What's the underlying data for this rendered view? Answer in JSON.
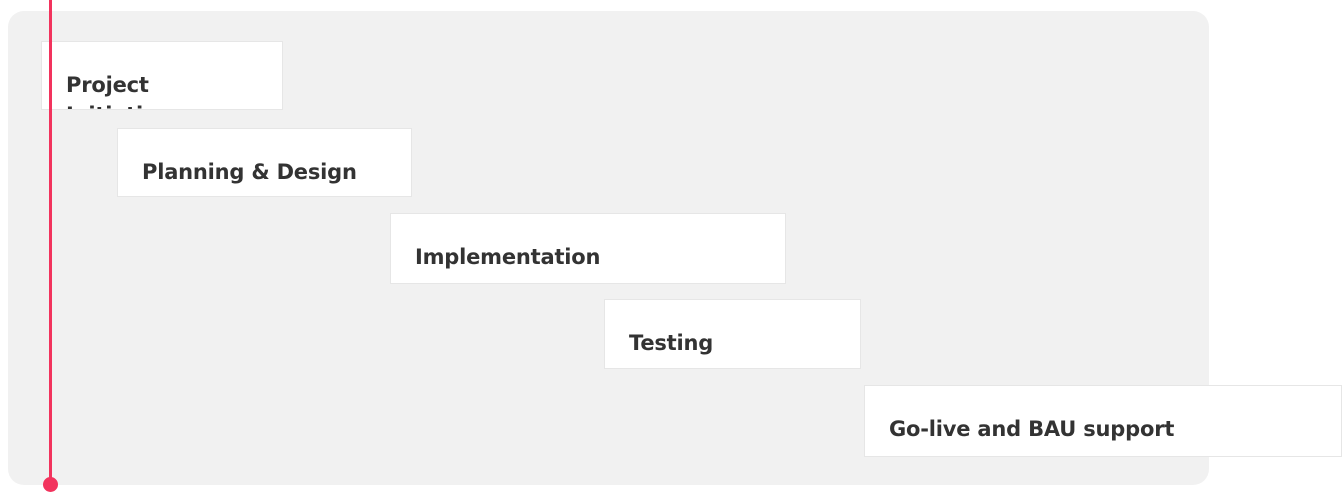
{
  "phases": [
    {
      "label": "Project Initiation"
    },
    {
      "label": "Planning & Design"
    },
    {
      "label": "Implementation"
    },
    {
      "label": "Testing"
    },
    {
      "label": "Go-live and BAU support"
    }
  ],
  "colors": {
    "accent": "#f2335d",
    "panel_background": "#f1f1f1",
    "card_background": "#ffffff",
    "text": "#333333"
  }
}
